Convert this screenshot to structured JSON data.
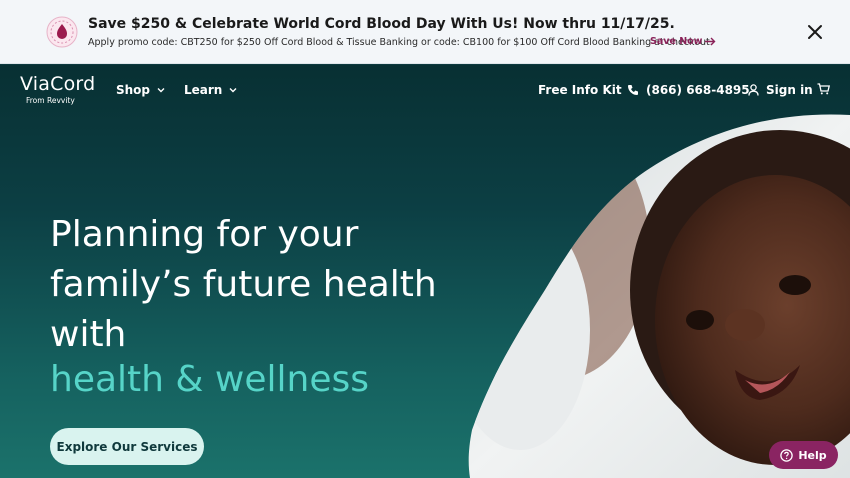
{
  "promo": {
    "title": "Save $250 & Celebrate World Cord Blood Day With Us! Now thru 11/17/25.",
    "subtitle": "Apply promo code: CBT250 for $250 Off Cord Blood & Tissue Banking or code: CB100 for $100 Off Cord Blood Banking at checkout.",
    "cta_label": "Save Now",
    "icon": "blood-drop-icon",
    "close_icon": "close-icon"
  },
  "nav": {
    "logo": "ViaCord",
    "logo_sub": "From Revvity",
    "shop_label": "Shop",
    "learn_label": "Learn",
    "info_kit_label": "Free Info Kit",
    "phone_label": "(866) 668-4895",
    "signin_label": "Sign in",
    "cart_icon": "cart-icon"
  },
  "hero": {
    "line1": "Planning for your",
    "line2": "family’s future health",
    "line3": "with",
    "line4": "health & wellness",
    "cta_label": "Explore Our Services",
    "image": "smiling-baby-photo"
  },
  "help": {
    "label": "Help"
  },
  "colors": {
    "accent": "#56d4c8",
    "brand_magenta": "#8a2462",
    "hero_dark": "#083033"
  }
}
